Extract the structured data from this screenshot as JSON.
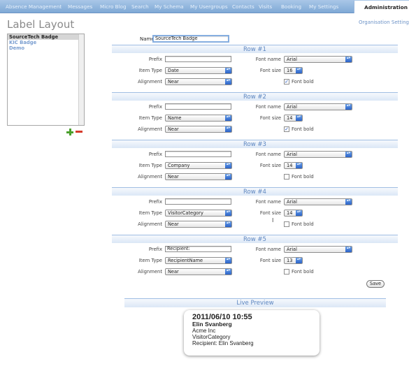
{
  "nav": {
    "tabs": [
      "Absence Management",
      "Messages",
      "Micro Blog",
      "Search",
      "My Schema",
      "My Usergroups",
      "Contacts",
      "Visits",
      "Booking",
      "My Settings"
    ],
    "active": "Administration"
  },
  "page_title": "Label Layout",
  "org_link": "Organisation Setting",
  "badges": [
    "SourceTech Badge",
    "KIC Badge",
    "Demo"
  ],
  "form": {
    "name_label": "Name",
    "name_value": "SourceTech Badge",
    "labels": {
      "prefix": "Prefix",
      "item_type": "Item Type",
      "alignment": "Alignment",
      "font_name": "Font name",
      "font_size": "Font size",
      "font_bold": "Font bold"
    },
    "rows": [
      {
        "title": "Row #1",
        "prefix": "",
        "item_type": "Date",
        "alignment": "Near",
        "font_name": "Arial",
        "font_size": "16",
        "bold": true
      },
      {
        "title": "Row #2",
        "prefix": "",
        "item_type": "Name",
        "alignment": "Near",
        "font_name": "Arial",
        "font_size": "14",
        "bold": true
      },
      {
        "title": "Row #3",
        "prefix": "",
        "item_type": "Company",
        "alignment": "Near",
        "font_name": "Arial",
        "font_size": "14",
        "bold": false
      },
      {
        "title": "Row #4",
        "prefix": "",
        "item_type": "VisitorCategory",
        "alignment": "Near",
        "font_name": "Arial",
        "font_size": "14",
        "bold": false
      },
      {
        "title": "Row #5",
        "prefix": "Recipient:",
        "item_type": "RecipientName",
        "alignment": "Near",
        "font_name": "Arial",
        "font_size": "13",
        "bold": false
      }
    ],
    "save_label": "Save"
  },
  "preview": {
    "title": "Live Preview",
    "lines": [
      "2011/06/10 10:55",
      "Elin Svanberg",
      "Acme Inc",
      "VisitorCategory",
      "Recipient: Elin Svanberg"
    ]
  }
}
